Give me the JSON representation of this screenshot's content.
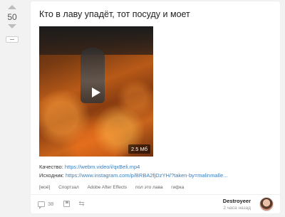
{
  "vote": {
    "rating": "50"
  },
  "post": {
    "title": "Кто в лаву упадёт, тот посуду и моет",
    "video": {
      "size_badge": "2.5 Мб"
    },
    "quality_label": "Качество:",
    "quality_link": "https://webm.video/i/qxBeli.mp4",
    "source_label": "Исходник:",
    "source_link": "https://www.instagram.com/p/BRBA2fjDzYH/?taken-by=malinmalle..."
  },
  "tags": [
    "[моё]",
    "Спортзал",
    "Adobe After Effects",
    "пол это лава",
    "гифка"
  ],
  "footer": {
    "comments_count": "38",
    "author_name": "Destroyeer",
    "time_ago": "2 часа назад"
  },
  "colors": {
    "link": "#3b7dbb",
    "background": "#f2f2f2",
    "card": "#ffffff"
  },
  "icons": [
    "arrow-up-icon",
    "arrow-down-icon",
    "minus-icon",
    "play-icon",
    "comment-icon",
    "save-icon",
    "share-icon"
  ]
}
